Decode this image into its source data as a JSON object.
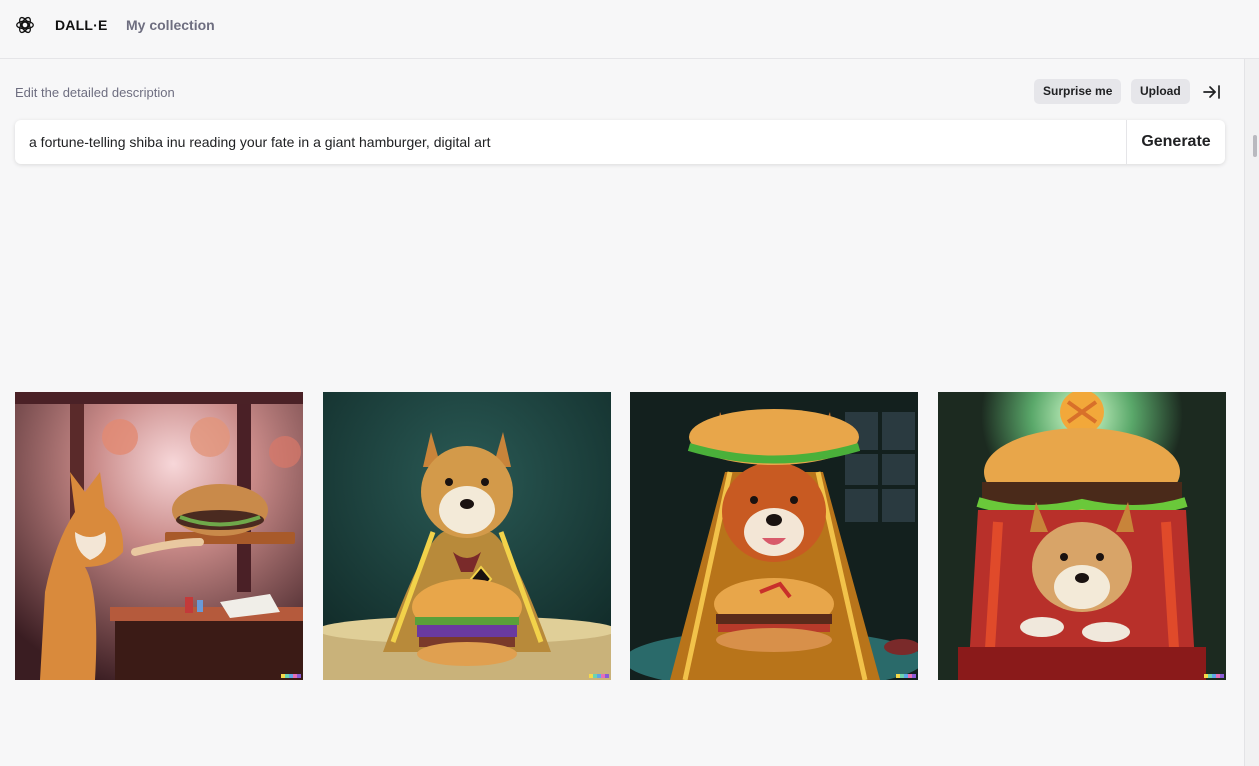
{
  "header": {
    "brand": "DALL·E",
    "nav_collection": "My collection"
  },
  "editor": {
    "hint": "Edit the detailed description",
    "surprise_label": "Surprise me",
    "upload_label": "Upload",
    "prompt_value": "a fortune-telling shiba inu reading your fate in a giant hamburger, digital art",
    "generate_label": "Generate"
  },
  "results": {
    "images": [
      {
        "name": "generated-image-1",
        "depicts": "shiba inu presenting a hamburger on a tray at a table"
      },
      {
        "name": "generated-image-2",
        "depicts": "shiba inu in a golden robe behind a hamburger"
      },
      {
        "name": "generated-image-3",
        "depicts": "shiba inu wearing a giant hamburger bun as a hat"
      },
      {
        "name": "generated-image-4",
        "depicts": "shiba inu sitting inside a giant glowing hamburger"
      }
    ],
    "watermark_colors": [
      "#f5d94a",
      "#6dd3b0",
      "#5fa7e8",
      "#e66fb5",
      "#8a5cd6"
    ]
  },
  "colors": {
    "background": "#f7f7f8",
    "pill_background": "#e6e6ea",
    "muted_text": "#6e6e80"
  },
  "icons": [
    "openai-logo-icon",
    "collapse-panel-icon"
  ]
}
